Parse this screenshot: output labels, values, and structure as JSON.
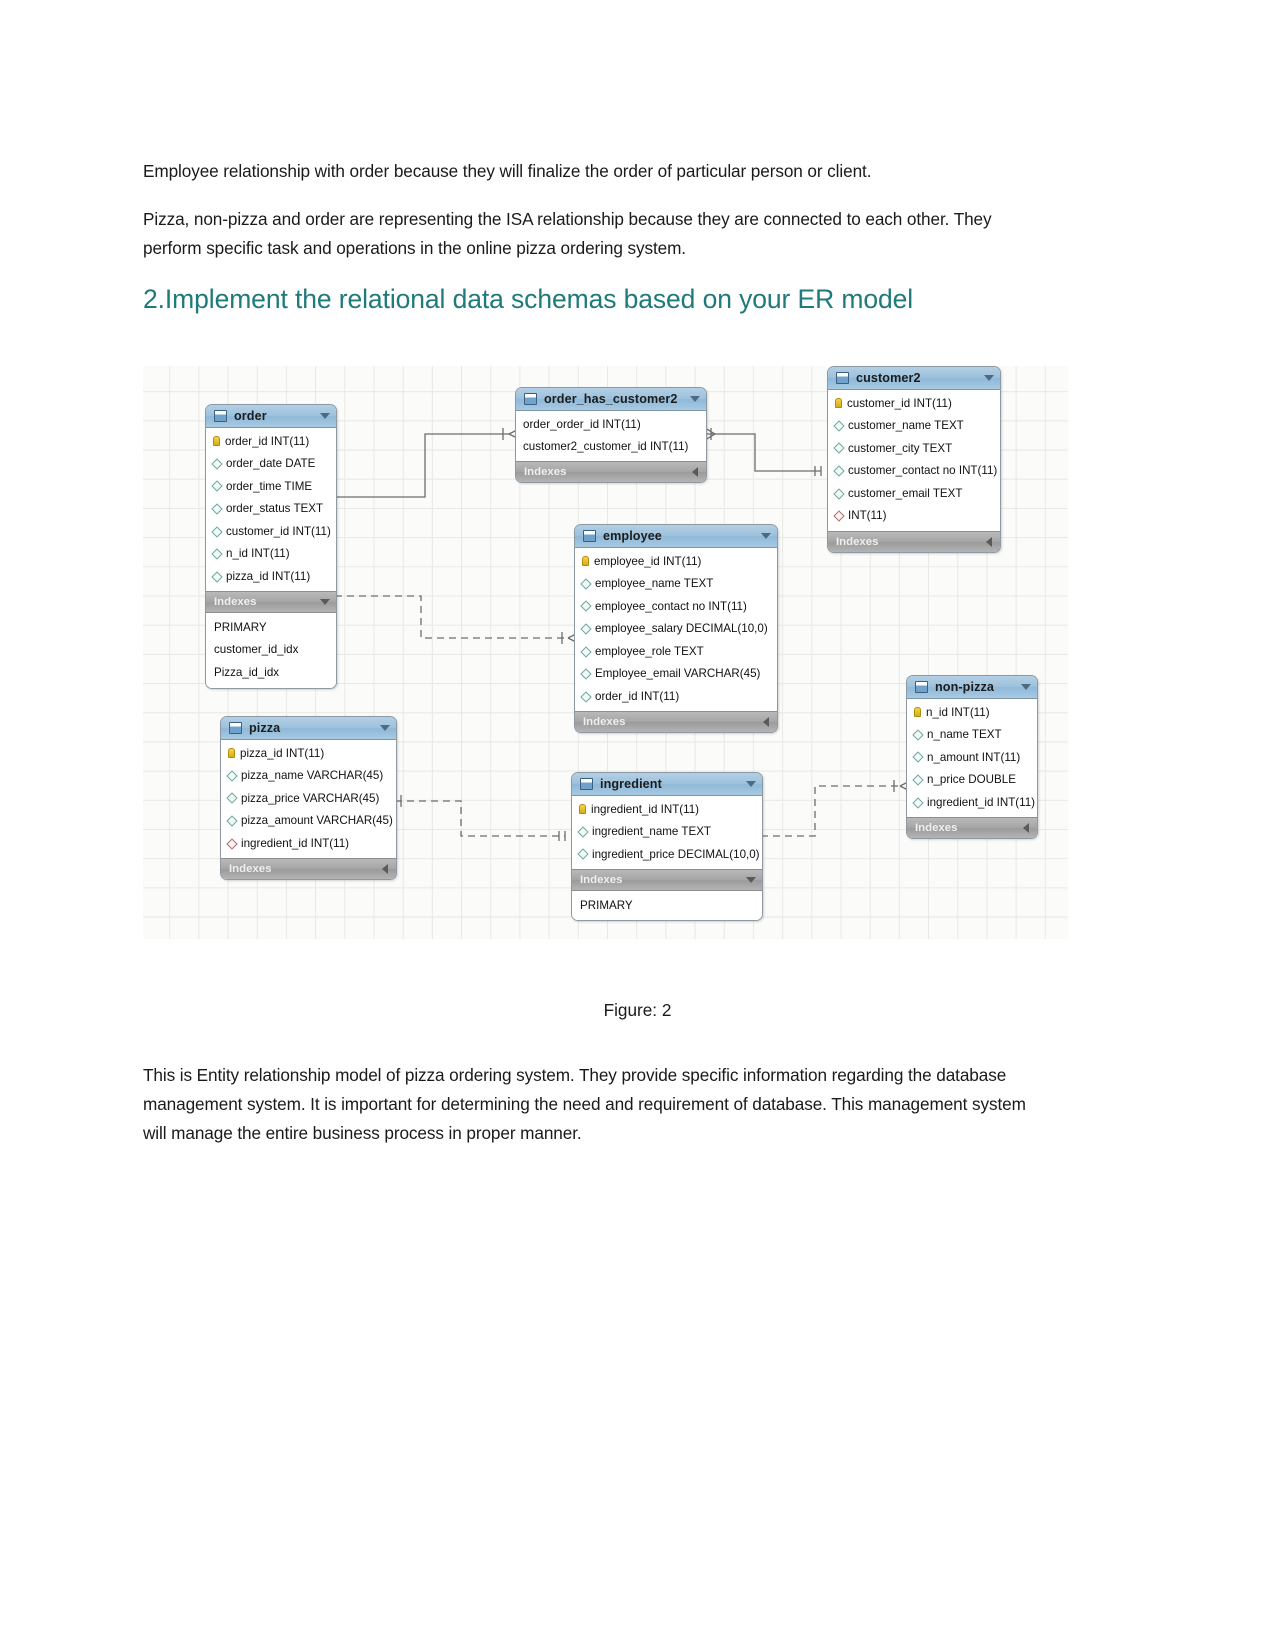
{
  "document": {
    "paragraph_1": "Employee relationship with order because they will finalize the order of particular person or client.",
    "paragraph_2": "Pizza, non-pizza and order are representing the ISA relationship because they are connected to each other. They perform specific task and operations in the online pizza ordering system.",
    "heading_2": "2.Implement the relational data schemas based on your ER model",
    "figure_caption": "Figure: 2",
    "paragraph_3": "This is Entity relationship model of pizza ordering system. They provide specific information regarding the database management system. It is important for determining the need and requirement of database. This management system will manage the entire business process in proper manner."
  },
  "colors": {
    "heading_teal": "#1f7a7a",
    "table_header_blue": "#9dc2dd",
    "index_bar_gray": "#a6a6a6",
    "key_icon_yellow": "#d8ab15",
    "column_icon_teal": "#6ba59a",
    "canvas_grid": "#e8e8e4"
  },
  "erd": {
    "indexes_label": "Indexes",
    "tables": [
      {
        "name": "order",
        "columns": [
          {
            "label": "order_id INT(11)",
            "icon": "primary-key-icon"
          },
          {
            "label": "order_date DATE",
            "icon": "column-icon"
          },
          {
            "label": "order_time TIME",
            "icon": "column-icon"
          },
          {
            "label": "order_status TEXT",
            "icon": "column-icon"
          },
          {
            "label": "customer_id INT(11)",
            "icon": "column-icon"
          },
          {
            "label": "n_id INT(11)",
            "icon": "column-icon"
          },
          {
            "label": "pizza_id INT(11)",
            "icon": "column-icon"
          }
        ],
        "indexes": [
          "PRIMARY",
          "customer_id_idx",
          "Pizza_id_idx"
        ]
      },
      {
        "name": "order_has_customer2",
        "columns": [
          {
            "label": "order_order_id INT(11)",
            "icon": "column-plain"
          },
          {
            "label": "customer2_customer_id INT(11)",
            "icon": "column-plain"
          }
        ],
        "indexes": []
      },
      {
        "name": "customer2",
        "columns": [
          {
            "label": "customer_id INT(11)",
            "icon": "primary-key-icon"
          },
          {
            "label": "customer_name TEXT",
            "icon": "column-icon"
          },
          {
            "label": "customer_city TEXT",
            "icon": "column-icon"
          },
          {
            "label": "customer_contact no INT(11)",
            "icon": "column-icon"
          },
          {
            "label": "customer_email TEXT",
            "icon": "column-icon"
          },
          {
            "label": "INT(11)",
            "icon": "column-icon-red"
          }
        ],
        "indexes": []
      },
      {
        "name": "employee",
        "columns": [
          {
            "label": "employee_id INT(11)",
            "icon": "primary-key-icon"
          },
          {
            "label": "employee_name TEXT",
            "icon": "column-icon"
          },
          {
            "label": "employee_contact no INT(11)",
            "icon": "column-icon"
          },
          {
            "label": "employee_salary DECIMAL(10,0)",
            "icon": "column-icon"
          },
          {
            "label": "employee_role TEXT",
            "icon": "column-icon"
          },
          {
            "label": "Employee_email VARCHAR(45)",
            "icon": "column-icon"
          },
          {
            "label": "order_id INT(11)",
            "icon": "column-icon"
          }
        ],
        "indexes": []
      },
      {
        "name": "pizza",
        "columns": [
          {
            "label": "pizza_id INT(11)",
            "icon": "primary-key-icon"
          },
          {
            "label": "pizza_name VARCHAR(45)",
            "icon": "column-icon"
          },
          {
            "label": "pizza_price VARCHAR(45)",
            "icon": "column-icon"
          },
          {
            "label": "pizza_amount VARCHAR(45)",
            "icon": "column-icon"
          },
          {
            "label": "ingredient_id INT(11)",
            "icon": "column-icon-red"
          }
        ],
        "indexes": []
      },
      {
        "name": "ingredient",
        "columns": [
          {
            "label": "ingredient_id INT(11)",
            "icon": "primary-key-icon"
          },
          {
            "label": "ingredient_name TEXT",
            "icon": "column-icon"
          },
          {
            "label": "ingredient_price DECIMAL(10,0)",
            "icon": "column-icon"
          }
        ],
        "indexes": [
          "PRIMARY"
        ]
      },
      {
        "name": "non-pizza",
        "columns": [
          {
            "label": "n_id INT(11)",
            "icon": "primary-key-icon"
          },
          {
            "label": "n_name TEXT",
            "icon": "column-icon"
          },
          {
            "label": "n_amount INT(11)",
            "icon": "column-icon"
          },
          {
            "label": "n_price DOUBLE",
            "icon": "column-icon"
          },
          {
            "label": "ingredient_id INT(11)",
            "icon": "column-icon"
          }
        ],
        "indexes": []
      }
    ]
  }
}
